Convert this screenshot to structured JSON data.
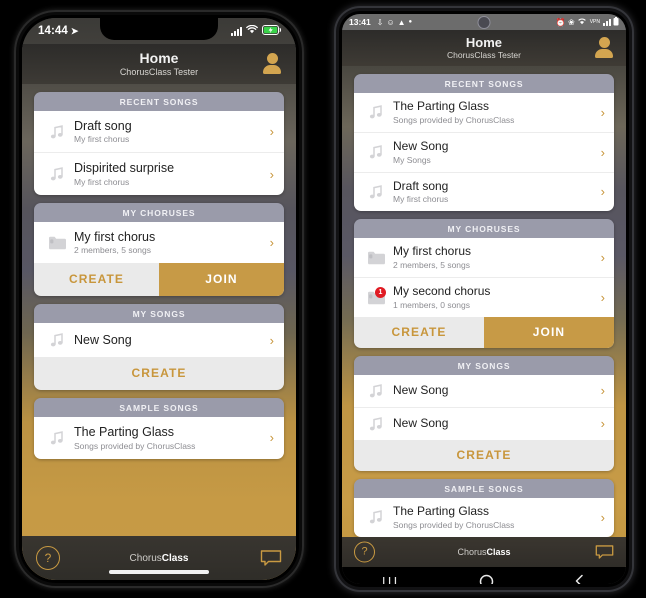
{
  "app": {
    "brand_prefix": "Chorus",
    "brand_suffix": "Class",
    "header_title": "Home",
    "header_subtitle": "ChorusClass Tester",
    "accent_gold": "#c79a46",
    "chevron": "›",
    "help_glyph": "?",
    "note_icon": "music-note",
    "folder_icon": "folder"
  },
  "iphone": {
    "status": {
      "time": "14:44",
      "location_glyph": "➤",
      "battery": "charging",
      "wifi": "wifi",
      "cellular": "signal"
    },
    "sections": [
      {
        "title": "RECENT SONGS",
        "rows": [
          {
            "icon": "music-note",
            "title": "Draft song",
            "subtitle": "My first chorus",
            "badge": ""
          },
          {
            "icon": "music-note",
            "title": "Dispirited surprise",
            "subtitle": "My first chorus",
            "badge": ""
          }
        ],
        "actions": []
      },
      {
        "title": "MY CHORUSES",
        "rows": [
          {
            "icon": "folder",
            "title": "My first chorus",
            "subtitle": "2 members, 5 songs",
            "badge": ""
          }
        ],
        "actions": [
          {
            "label": "CREATE",
            "style": "plain"
          },
          {
            "label": "JOIN",
            "style": "filled"
          }
        ]
      },
      {
        "title": "MY SONGS",
        "rows": [
          {
            "icon": "music-note",
            "title": "New Song",
            "subtitle": "",
            "badge": ""
          }
        ],
        "actions": [
          {
            "label": "CREATE",
            "style": "plain"
          }
        ]
      },
      {
        "title": "SAMPLE SONGS",
        "rows": [
          {
            "icon": "music-note",
            "title": "The Parting Glass",
            "subtitle": "Songs provided by ChorusClass",
            "badge": ""
          }
        ],
        "actions": []
      }
    ]
  },
  "android": {
    "status": {
      "time": "13:41",
      "left_icons": [
        "download-icon",
        "emoji-icon",
        "warning-icon",
        "dot-icon"
      ],
      "right_icons": [
        "alarm-icon",
        "bluetooth-icon",
        "wifi-icon",
        "vpn-icon",
        "signal-icon",
        "battery-icon"
      ]
    },
    "navbar": {
      "recents": "recents-button",
      "home": "home-button",
      "back": "back-button"
    },
    "sections": [
      {
        "title": "RECENT SONGS",
        "rows": [
          {
            "icon": "music-note",
            "title": "The Parting Glass",
            "subtitle": "Songs provided by ChorusClass",
            "badge": ""
          },
          {
            "icon": "music-note",
            "title": "New Song",
            "subtitle": "My Songs",
            "badge": ""
          },
          {
            "icon": "music-note",
            "title": "Draft song",
            "subtitle": "My first chorus",
            "badge": ""
          }
        ],
        "actions": []
      },
      {
        "title": "MY CHORUSES",
        "rows": [
          {
            "icon": "folder",
            "title": "My first chorus",
            "subtitle": "2 members, 5 songs",
            "badge": ""
          },
          {
            "icon": "folder",
            "title": "My second chorus",
            "subtitle": "1 members, 0 songs",
            "badge": "1"
          }
        ],
        "actions": [
          {
            "label": "CREATE",
            "style": "plain"
          },
          {
            "label": "JOIN",
            "style": "filled"
          }
        ]
      },
      {
        "title": "MY SONGS",
        "rows": [
          {
            "icon": "music-note",
            "title": "New Song",
            "subtitle": "",
            "badge": ""
          },
          {
            "icon": "music-note",
            "title": "New Song",
            "subtitle": "",
            "badge": ""
          }
        ],
        "actions": [
          {
            "label": "CREATE",
            "style": "plain"
          }
        ]
      },
      {
        "title": "SAMPLE SONGS",
        "rows": [
          {
            "icon": "music-note",
            "title": "The Parting Glass",
            "subtitle": "Songs provided by ChorusClass",
            "badge": ""
          }
        ],
        "actions": []
      }
    ]
  }
}
